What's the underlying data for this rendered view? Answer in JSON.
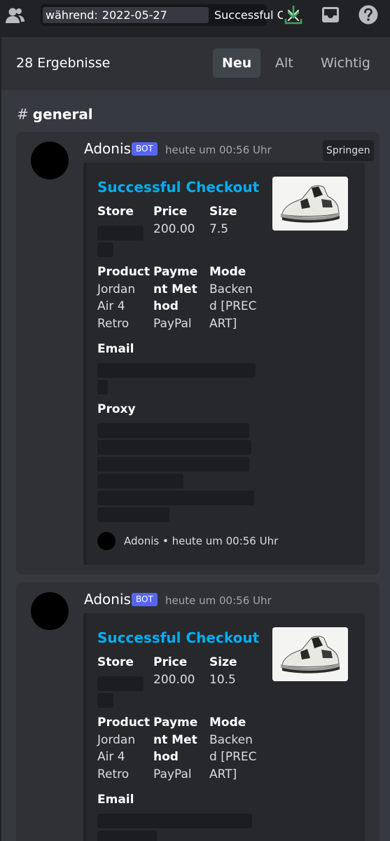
{
  "search": {
    "filter_key": "während:",
    "filter_value": "2022-05-27",
    "query": "Successful C"
  },
  "results": {
    "count_label": "28 Ergebnisse",
    "tabs": [
      "Neu",
      "Alt",
      "Wichtig"
    ],
    "active_tab": "Neu"
  },
  "channel": {
    "hash": "#",
    "name": "general"
  },
  "messages": [
    {
      "author": "Adonis",
      "bot_tag": "BOT",
      "timestamp": "heute um 00:56 Uhr",
      "jump_label": "Springen",
      "embed": {
        "title": "Successful Checkout",
        "store_label": "Store",
        "price_label": "Price",
        "price_value": "200.00",
        "size_label": "Size",
        "size_value": "7.5",
        "product_label": "Product",
        "product_value": "Jordan Air 4 Retro",
        "payment_label": "Payment Method",
        "payment_value": "PayPal",
        "mode_label": "Mode",
        "mode_value": "Backend [PRECART]",
        "email_label": "Email",
        "proxy_label": "Proxy",
        "footer_author": "Adonis",
        "footer_time": "heute um 00:56 Uhr"
      }
    },
    {
      "author": "Adonis",
      "bot_tag": "BOT",
      "timestamp": "heute um 00:56 Uhr",
      "embed": {
        "title": "Successful Checkout",
        "store_label": "Store",
        "price_label": "Price",
        "price_value": "200.00",
        "size_label": "Size",
        "size_value": "10.5",
        "product_label": "Product",
        "product_value": "Jordan Air 4 Retro",
        "payment_label": "Payment Method",
        "payment_value": "PayPal",
        "mode_label": "Mode",
        "mode_value": "Backend [PRECART]",
        "email_label": "Email"
      }
    }
  ],
  "colors": {
    "accent_link": "#00aff4",
    "bot_tag": "#5865f2",
    "download_icon": "#3ba55d"
  },
  "icons": [
    "members-icon",
    "close-icon",
    "download-icon",
    "inbox-icon",
    "help-icon"
  ]
}
